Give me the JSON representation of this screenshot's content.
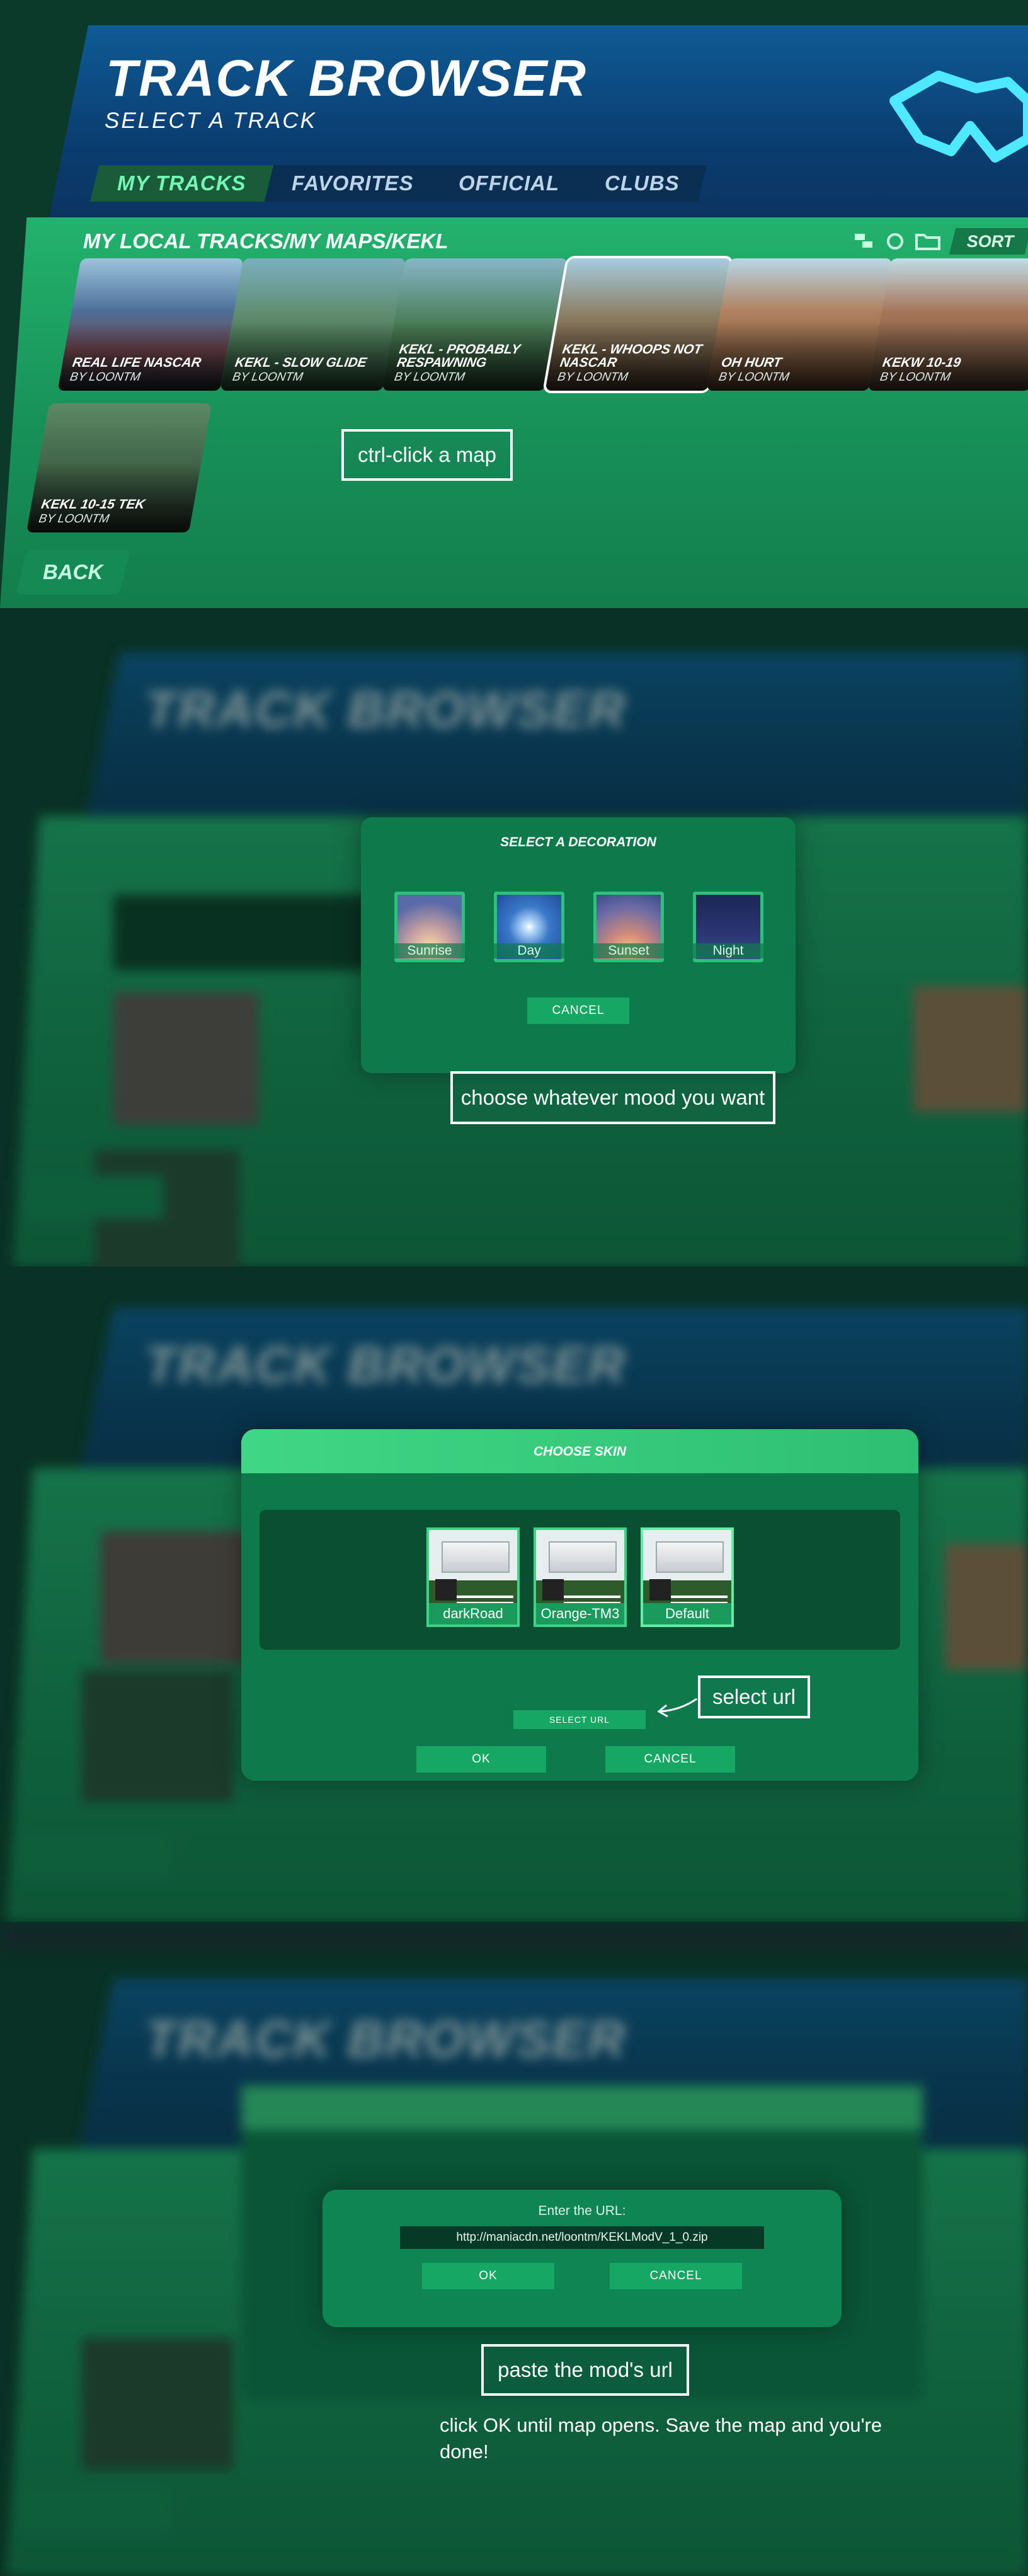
{
  "browser": {
    "title": "TRACK BROWSER",
    "subtitle": "SELECT A TRACK",
    "tabs": [
      "MY TRACKS",
      "FAVORITES",
      "OFFICIAL",
      "CLUBS"
    ],
    "path": "MY LOCAL TRACKS/MY MAPS/KEKL",
    "sort_label": "SORT",
    "back_label": "BACK",
    "maps": [
      {
        "name": "REAL LIFE NASCAR",
        "author": "BY LOONTM"
      },
      {
        "name": "KEKL - SLOW GLIDE",
        "author": "BY LOONTM"
      },
      {
        "name": "KEKL - PROBABLY RESPAWNING",
        "author": "BY LOONTM"
      },
      {
        "name": "KEKL - WHOOPS NOT NASCAR",
        "author": "BY LOONTM"
      },
      {
        "name": "OH HURT",
        "author": "BY LOONTM"
      },
      {
        "name": "KEKW 10-19",
        "author": "BY LOONTM"
      },
      {
        "name": "KEKL 10-15 TEK",
        "author": "BY LOONTM"
      }
    ]
  },
  "notes": {
    "step1": "ctrl-click a map",
    "step2": "choose whatever mood you want",
    "step3": "select url",
    "step4": "paste the mod's url",
    "step5": "click OK until map opens. Save the map and you're done!"
  },
  "decoration_dialog": {
    "title": "SELECT A DECORATION",
    "options": [
      "Sunrise",
      "Day",
      "Sunset",
      "Night"
    ],
    "cancel_label": "CANCEL"
  },
  "skin_dialog": {
    "title": "CHOOSE SKIN",
    "skins": [
      "darkRoad",
      "Orange-TM3",
      "Default"
    ],
    "select_url_label": "SELECT URL",
    "ok_label": "OK",
    "cancel_label": "CANCEL"
  },
  "url_dialog": {
    "prompt": "Enter the URL:",
    "value": "http://maniacdn.net/loontm/KEKLModV_1_0.zip",
    "ok_label": "OK",
    "cancel_label": "CANCEL"
  },
  "colors": {
    "accent_green": "#74f7b4",
    "header_blue": "#0f5b96",
    "body_green": "#179058",
    "button_green": "#17a764"
  }
}
